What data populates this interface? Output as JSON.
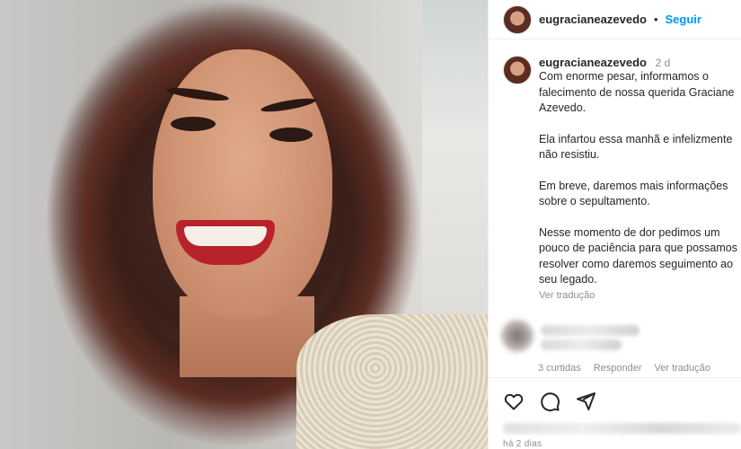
{
  "header": {
    "username": "eugracianeazevedo",
    "separator": "•",
    "follow_label": "Seguir"
  },
  "caption": {
    "username": "eugracianeazevedo",
    "time": "2 d",
    "paragraphs": [
      [
        "Com enorme pesar, informamos o",
        "falecimento de nossa querida Graciane",
        "Azevedo."
      ],
      [
        "Ela infartou essa manhã e infelizmente",
        "não resistiu."
      ],
      [
        "Em breve, daremos mais informações",
        "sobre o sepultamento."
      ],
      [
        "Nesse momento de dor pedimos um",
        "pouco de paciência para que possamos",
        "resolver como daremos seguimento ao",
        "seu legado."
      ]
    ],
    "translate_label": "Ver tradução"
  },
  "comment": {
    "likes_label": "3 curtidas",
    "reply_label": "Responder",
    "translate_label": "Ver tradução"
  },
  "actions": {
    "like_icon": "heart-icon",
    "comment_icon": "comment-icon",
    "share_icon": "share-icon"
  },
  "footer": {
    "posted_label": "há 2 dias"
  }
}
